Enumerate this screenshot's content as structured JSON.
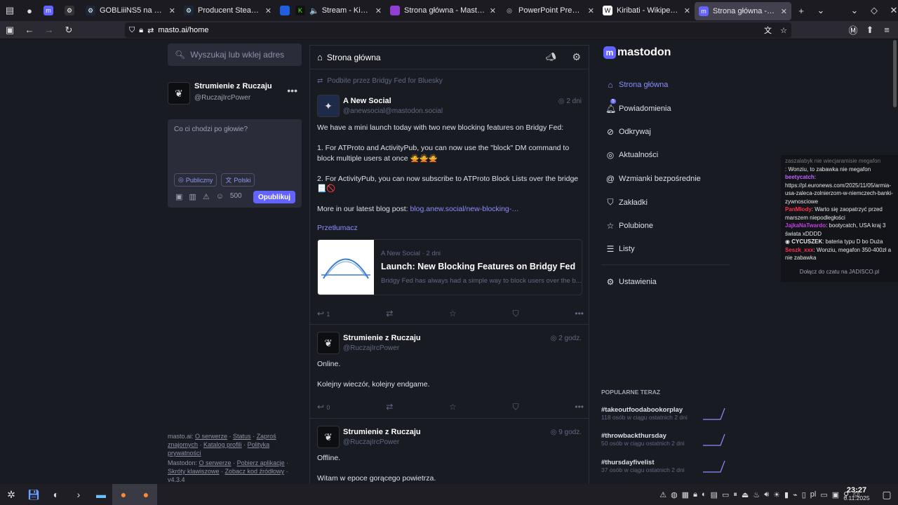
{
  "tabs": [
    {
      "label": "",
      "color": "#6364ff"
    },
    {
      "label": "GOBLiiiNS5 na Steam",
      "color": "#1b2838"
    },
    {
      "label": "Producent Steam: Schm",
      "color": "#1b2838"
    },
    {
      "label": "Stream - Kick Dashbo",
      "color": "#53fc18"
    },
    {
      "label": "Strona główna - Mastod",
      "color": "#6364ff"
    },
    {
      "label": "PowerPoint Presentatio",
      "color": "#2b2a33"
    },
    {
      "label": "Kiribati - Wikipedia",
      "color": "#ffffff"
    },
    {
      "label": "Strona główna - Mastod",
      "color": "#6364ff"
    }
  ],
  "url": "masto.ai/home",
  "search": {
    "placeholder": "Wyszukaj lub wklej adres"
  },
  "profile": {
    "name": "Strumienie z Ruczaju",
    "handle": "@RuczajIrcPower"
  },
  "compose": {
    "placeholder": "Co ci chodzi po głowie?",
    "visibility": "Publiczny",
    "language": "Polski",
    "counter": "500",
    "publish": "Opublikuj"
  },
  "column": {
    "title": "Strona główna"
  },
  "statuses": [
    {
      "boost": "Podbite przez Bridgy Fed for Bluesky",
      "name": "A New Social",
      "handle": "@anewsocial@mastodon.social",
      "time": "2 dni",
      "lines": [
        "We have a mini launch today with two new blocking features on Bridgy Fed:",
        "1. For ATProto and ActivityPub, you can now use the \"block\" DM command to block multiple users at once 🙅🙅🙅",
        "2. For ActivityPub, you can now subscribe to ATProto Block Lists over the bridge 📃🚫"
      ],
      "more": "More in our latest blog post: ",
      "link": "blog.anew.social/new-blocking-…",
      "translate": "Przetłumacz",
      "card": {
        "meta": "A New Social · 2 dni",
        "title": "Launch: New Blocking Features on Bridgy Fed",
        "desc": "Bridgy Fed has always had a simple way to block users over the b..."
      },
      "replies": "1"
    },
    {
      "name": "Strumienie z Ruczaju",
      "handle": "@RuczajIrcPower",
      "time": "2 godz.",
      "lines": [
        "Online.",
        "Kolejny wieczór, kolejny endgame."
      ],
      "replies": "0"
    },
    {
      "name": "Strumienie z Ruczaju",
      "handle": "@RuczajIrcPower",
      "time": "9 godz.",
      "lines": [
        "Offline.",
        "Witam w epoce gorącego powietrza."
      ]
    }
  ],
  "logo": "mastodon",
  "nav": [
    {
      "label": "Strona główna",
      "icon": "home-icon"
    },
    {
      "label": "Powiadomienia",
      "icon": "bell-icon",
      "badge": "5"
    },
    {
      "label": "Odkrywaj",
      "icon": "compass-icon"
    },
    {
      "label": "Aktualności",
      "icon": "globe-icon"
    },
    {
      "label": "Wzmianki bezpośrednie",
      "icon": "at-icon"
    },
    {
      "label": "Zakładki",
      "icon": "bookmark-icon"
    },
    {
      "label": "Polubione",
      "icon": "star-icon"
    },
    {
      "label": "Listy",
      "icon": "list-icon"
    },
    {
      "label": "Ustawienia",
      "icon": "gear-icon"
    }
  ],
  "trending": {
    "heading": "POPULARNE TERAZ",
    "items": [
      {
        "tag": "#takeoutfoodabookorplay",
        "sub": "118 osób w ciągu ostatnich 2 dni"
      },
      {
        "tag": "#throwbackthursday",
        "sub": "50 osób w ciągu ostatnich 2 dni"
      },
      {
        "tag": "#thursdayfivelist",
        "sub": "37 osób w ciągu ostatnich 2 dni"
      }
    ]
  },
  "footer": {
    "server": "masto.ai:",
    "links1": [
      "O serwerze",
      "Status",
      "Zaproś znajomych",
      "Katalog profili",
      "Polityka prywatności"
    ],
    "app": "Mastodon:",
    "links2": [
      "O serwerze",
      "Pobierz aplikacje",
      "Skróty klawiszowe",
      "Zobacz kod źródłowy"
    ],
    "version": "v4.3.4"
  },
  "chat": {
    "lines": [
      {
        "user": "",
        "text": "zaszalabyk nie wiecjaramisie megafon"
      },
      {
        "user": "",
        "text": ": Wonziu, to zabawka nie megafon",
        "color": "#d01030"
      },
      {
        "user": "beetycatch",
        "text": ": https://pl.euronews.com/2025/11/05/armia-usa-zaleca-zolnierzom-w-niemczech-banki-zywnosciowe",
        "color": "#c060ff"
      },
      {
        "user": "PanMlody",
        "text": ": Warto się zaopatrzyć przed marszem niepodległości",
        "color": "#ff3050"
      },
      {
        "user": "JajkaNaTwardo",
        "text": ": bootycatch, USA kraj 3 świata xDDDD",
        "color": "#c040e0"
      },
      {
        "user": "CYCUSZEK",
        "text": ": bateria typu D bo Duża",
        "color": "#ffffff"
      },
      {
        "user": "Seszk_xxx",
        "text": ": Wonziu, megafon 350-400zł a nie zabawka",
        "color": "#ff3050"
      }
    ],
    "join": "Dołącz do czatu na JADISCO.pl"
  },
  "clock": {
    "time": "23:27",
    "date": "6.11.2025"
  },
  "tray_lang": "pl"
}
